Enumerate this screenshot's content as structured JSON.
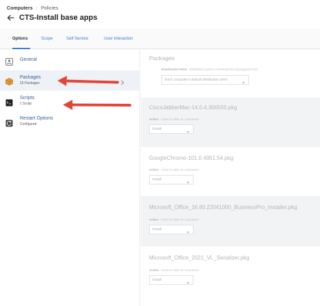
{
  "breadcrumb": {
    "root": "Computers",
    "separator": ":",
    "current": "Policies"
  },
  "page_title": "CTS-Install base apps",
  "tabs": [
    {
      "label": "Options",
      "active": true
    },
    {
      "label": "Scope",
      "active": false
    },
    {
      "label": "Self Service",
      "active": false
    },
    {
      "label": "User Interaction",
      "active": false
    }
  ],
  "sidebar": {
    "items": [
      {
        "label": "General",
        "sub": "",
        "icon": "general-icon"
      },
      {
        "label": "Packages",
        "sub": "15 Packages",
        "icon": "package-icon",
        "selected": true
      },
      {
        "label": "Scripts",
        "sub": "1 Script",
        "icon": "script-icon"
      },
      {
        "label": "Restart Options",
        "sub": "Configured",
        "icon": "restart-icon"
      }
    ]
  },
  "main": {
    "section_title": "Packages",
    "distribution_point": {
      "label": "Distribution Point",
      "hint": "Distribution point to download the package(s) from",
      "value": "Each computer's default distribution point"
    },
    "packages": [
      {
        "name": "CiscoJabberMac-14.0.4.306555.pkg",
        "action_label": "Action",
        "action_hint": "Action to take on computers",
        "action_value": "Install"
      },
      {
        "name": "GoogleChrome-101.0.4951.54.pkg",
        "action_label": "Action",
        "action_hint": "Action to take on computers",
        "action_value": "Install"
      },
      {
        "name": "Microsoft_Office_16.60.22041000_BusinessPro_Installer.pkg",
        "action_label": "Action",
        "action_hint": "Action to take on computers",
        "action_value": "Install"
      },
      {
        "name": "Microsoft_Office_2021_VL_Serializer.pkg",
        "action_label": "Action",
        "action_hint": "Action to take on computers",
        "action_value": "Install"
      }
    ]
  },
  "colors": {
    "accent": "#3a7bd5",
    "annotation_arrow": "#e2463a",
    "shaded_row": "#f2f3f5"
  }
}
